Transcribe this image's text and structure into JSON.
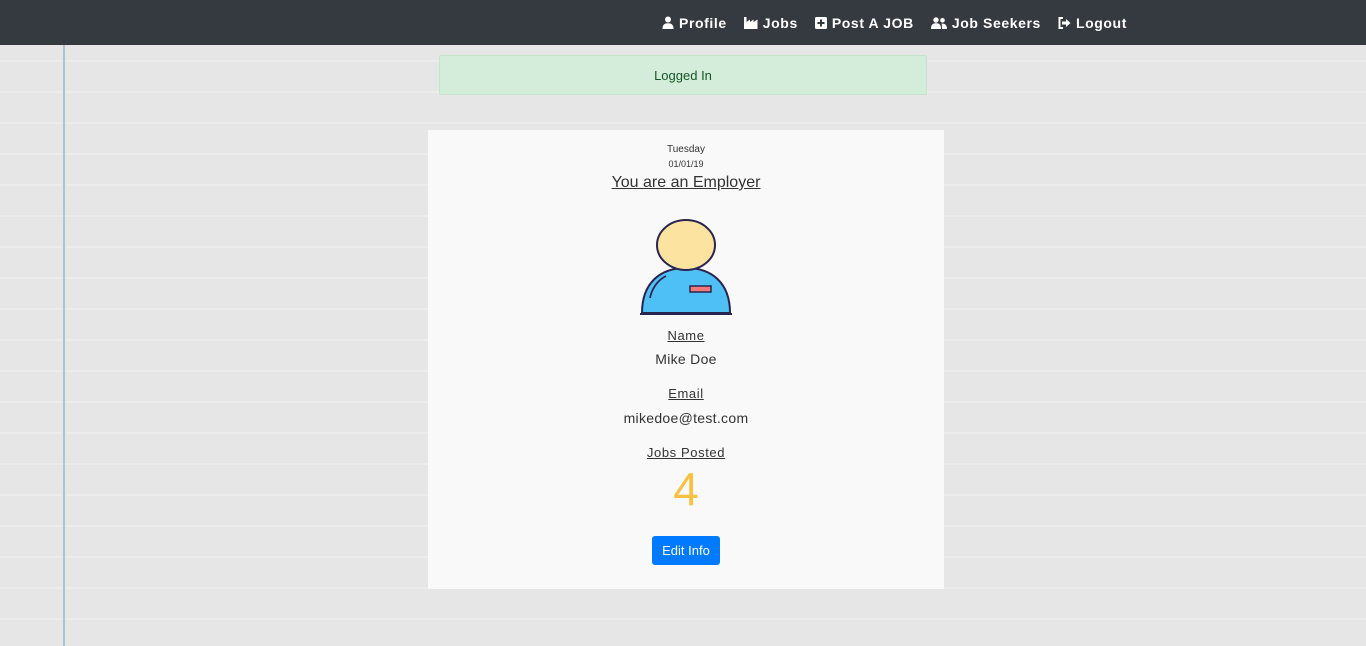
{
  "nav": {
    "items": [
      {
        "label": "Profile",
        "icon": "user-icon"
      },
      {
        "label": "Jobs",
        "icon": "factory-icon"
      },
      {
        "label": "Post A JOB",
        "icon": "plus-square-icon"
      },
      {
        "label": "Job Seekers",
        "icon": "users-icon"
      },
      {
        "label": "Logout",
        "icon": "sign-out-icon"
      }
    ]
  },
  "alert": {
    "message": "Logged In"
  },
  "profile": {
    "day": "Tuesday",
    "date": "01/01/19",
    "role": "You are an Employer",
    "avatar_icon": "employee-avatar-icon",
    "name_label": "Name",
    "name_value": "Mike Doe",
    "email_label": "Email",
    "email_value": "mikedoe@test.com",
    "jobs_label": "Jobs Posted",
    "jobs_count": "4",
    "edit_button": "Edit Info"
  },
  "colors": {
    "navbar": "#343a40",
    "alert_bg": "#d4edda",
    "alert_text": "#155724",
    "count": "#f7c244",
    "button": "#007bff",
    "avatar_head": "#fde3a0",
    "avatar_body": "#4fc0f5",
    "badge": "#f07a7a"
  }
}
